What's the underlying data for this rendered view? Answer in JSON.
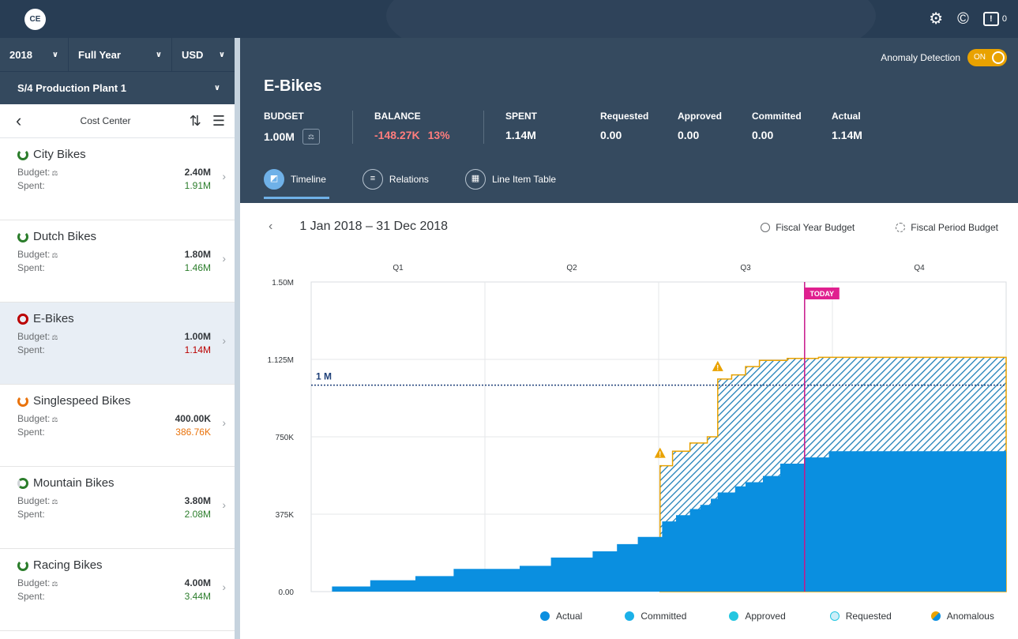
{
  "topbar": {
    "avatar": "CE",
    "settings_icon": "gear-icon",
    "help_icon": "copyright-icon",
    "notifications_icon": "notification-icon",
    "notifications_count": "0"
  },
  "filters": {
    "year": "2018",
    "period": "Full Year",
    "currency": "USD",
    "plant": "S/4 Production Plant 1"
  },
  "sidebar": {
    "header_label": "Cost Center",
    "budget_label": "Budget:",
    "spent_label": "Spent:",
    "items": [
      {
        "name": "City Bikes",
        "budget": "2.40M",
        "spent": "1.91M",
        "status_color": "#2b7d2b",
        "spent_color": "#2b7d2b"
      },
      {
        "name": "Dutch Bikes",
        "budget": "1.80M",
        "spent": "1.46M",
        "status_color": "#2b7d2b",
        "spent_color": "#2b7d2b"
      },
      {
        "name": "E-Bikes",
        "budget": "1.00M",
        "spent": "1.14M",
        "status_color": "#bb0000",
        "spent_color": "#bb0000",
        "selected": true
      },
      {
        "name": "Singlespeed Bikes",
        "budget": "400.00K",
        "spent": "386.76K",
        "status_color": "#e9730c",
        "spent_color": "#e9730c"
      },
      {
        "name": "Mountain Bikes",
        "budget": "3.80M",
        "spent": "2.08M",
        "status_color": "#2b7d2b",
        "spent_color": "#2b7d2b"
      },
      {
        "name": "Racing Bikes",
        "budget": "4.00M",
        "spent": "3.44M",
        "status_color": "#2b7d2b",
        "spent_color": "#2b7d2b"
      }
    ]
  },
  "header": {
    "anomaly_label": "Anomaly Detection",
    "anomaly_toggle": "ON",
    "title": "E-Bikes",
    "kpis": {
      "budget_label": "BUDGET",
      "budget_value": "1.00M",
      "balance_label": "BALANCE",
      "balance_value": "-148.27K",
      "balance_pct": "13%",
      "spent_label": "SPENT",
      "spent_value": "1.14M",
      "requested_label": "Requested",
      "requested_value": "0.00",
      "approved_label": "Approved",
      "approved_value": "0.00",
      "committed_label": "Committed",
      "committed_value": "0.00",
      "actual_label": "Actual",
      "actual_value": "1.14M"
    },
    "tabs": [
      {
        "label": "Timeline",
        "active": true
      },
      {
        "label": "Relations"
      },
      {
        "label": "Line Item Table"
      }
    ]
  },
  "chart": {
    "date_range": "1 Jan 2018 – 31 Dec 2018",
    "fiscal_year_budget": "Fiscal Year Budget",
    "fiscal_period_budget": "Fiscal Period Budget",
    "today_label": "TODAY",
    "budget_line_label": "1 M",
    "legend": [
      {
        "label": "Actual",
        "color": "#0a8fe0"
      },
      {
        "label": "Committed",
        "color": "#1bb0e8"
      },
      {
        "label": "Approved",
        "color": "#23c6e0"
      },
      {
        "label": "Requested",
        "color": "#cdeef8"
      },
      {
        "label": "Anomalous",
        "color": "#e9a200"
      }
    ]
  },
  "chart_data": {
    "type": "area",
    "quarters": [
      "Q1",
      "Q2",
      "Q3",
      "Q4"
    ],
    "y_ticks": [
      "0.00",
      "375K",
      "750K",
      "1.125M",
      "1.50M"
    ],
    "ylim": [
      0,
      1500000
    ],
    "budget": 1000000,
    "today_fraction": 0.71,
    "warning_fractions": [
      0.502,
      0.585
    ],
    "actual_steps": [
      [
        0.03,
        25000
      ],
      [
        0.085,
        55000
      ],
      [
        0.15,
        75000
      ],
      [
        0.205,
        110000
      ],
      [
        0.3,
        125000
      ],
      [
        0.345,
        165000
      ],
      [
        0.405,
        195000
      ],
      [
        0.44,
        230000
      ],
      [
        0.47,
        265000
      ],
      [
        0.505,
        340000
      ],
      [
        0.525,
        370000
      ],
      [
        0.545,
        400000
      ],
      [
        0.56,
        420000
      ],
      [
        0.575,
        450000
      ],
      [
        0.585,
        480000
      ],
      [
        0.61,
        510000
      ],
      [
        0.625,
        530000
      ],
      [
        0.65,
        560000
      ],
      [
        0.675,
        620000
      ],
      [
        0.71,
        650000
      ],
      [
        0.745,
        680000
      ],
      [
        1.0,
        680000
      ]
    ],
    "anomalous_steps": [
      [
        0.502,
        610000
      ],
      [
        0.52,
        680000
      ],
      [
        0.545,
        720000
      ],
      [
        0.57,
        750000
      ],
      [
        0.585,
        1030000
      ],
      [
        0.605,
        1050000
      ],
      [
        0.625,
        1090000
      ],
      [
        0.645,
        1120000
      ],
      [
        0.685,
        1130000
      ],
      [
        0.73,
        1135000
      ],
      [
        1.0,
        1135000
      ]
    ]
  }
}
